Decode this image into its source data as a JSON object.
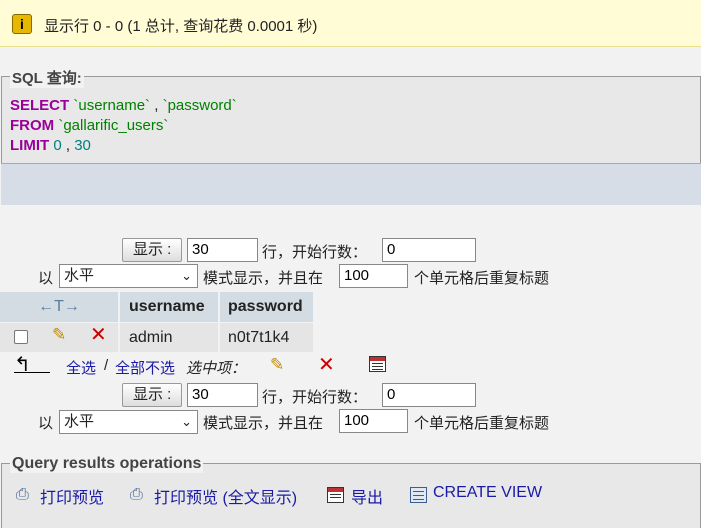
{
  "notice": {
    "icon": "info-icon",
    "message": "显示行 0 - 0 (1 总计, 查询花费 0.0001 秒)"
  },
  "sql": {
    "legend": "SQL 查询:",
    "line1_kw": "SELECT",
    "line1_col1": "`username`",
    "line1_sep": " , ",
    "line1_col2": "`password`",
    "line2_kw": "FROM",
    "line2_tbl": "`gallarific_users`",
    "line3_kw": "LIMIT",
    "line3_offset": "0",
    "line3_sep": " , ",
    "line3_count": "30"
  },
  "nav_top": {
    "show_button": "显示 :",
    "rows_value": "30",
    "rows_label": "行，开始行数：",
    "start_value": "0",
    "mode_prefix": "以",
    "mode_value": "水平",
    "mode_label": "模式显示，并且在",
    "repeat_value": "100",
    "repeat_label": "个单元格后重复标题"
  },
  "table": {
    "columns": [
      "username",
      "password"
    ],
    "rows": [
      {
        "username": "admin",
        "password": "n0t7t1k4"
      }
    ]
  },
  "bulk": {
    "check_all": "全选",
    "sep": "/",
    "uncheck_all": "全部不选",
    "with_selected": "选中项："
  },
  "nav_bottom": {
    "show_button": "显示 :",
    "rows_value": "30",
    "rows_label": "行，开始行数：",
    "start_value": "0",
    "mode_prefix": "以",
    "mode_value": "水平",
    "mode_label": "模式显示，并且在",
    "repeat_value": "100",
    "repeat_label": "个单元格后重复标题"
  },
  "ops": {
    "legend": "Query results operations",
    "print": "打印预览",
    "print_full": "打印预览 (全文显示)",
    "export": "导出",
    "create_view": "CREATE VIEW"
  }
}
